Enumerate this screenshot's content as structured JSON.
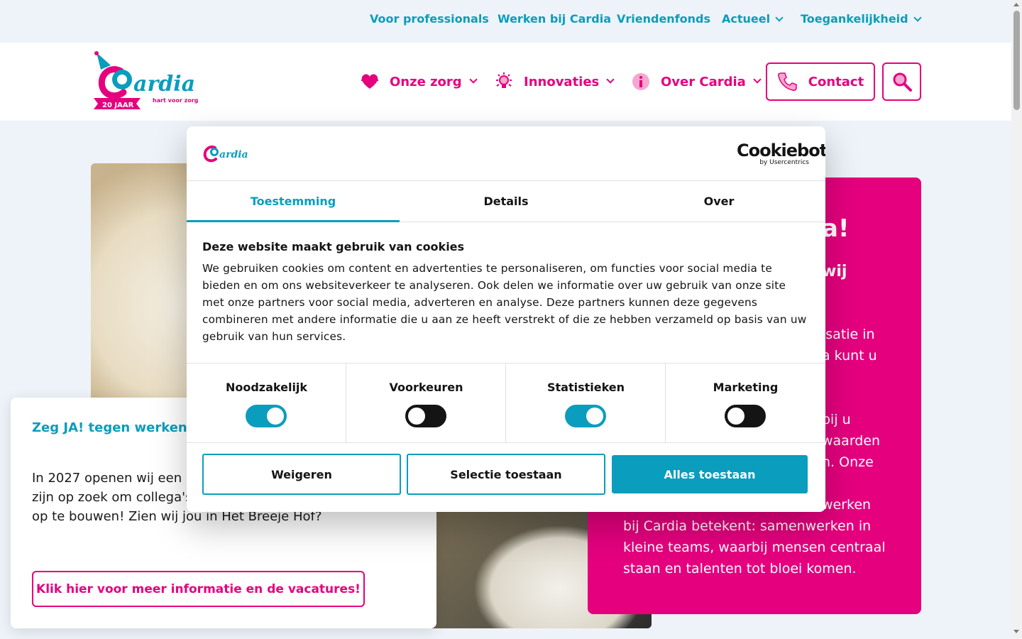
{
  "topbar": {
    "links": [
      "Voor professionals",
      "Werken bij Cardia",
      "Vriendenfonds",
      "Actueel",
      "Toegankelijkheid"
    ]
  },
  "brand": {
    "name": "Cardia",
    "tagline": "hart voor zorg",
    "badge": "20 JAAR",
    "pink": "#e5007e",
    "blue": "#0a9dbd"
  },
  "nav": {
    "items": [
      "Onze zorg",
      "Innovaties",
      "Over Cardia"
    ],
    "contact": "Contact"
  },
  "hero": {
    "heading_fragment": "a!",
    "subheading_fragment": "wij",
    "body_lines": [
      "isatie in",
      "a kunt u",
      "bij u",
      "waarden",
      "n. Onze",
      "werken",
      "bij Cardia betekent: samenwerken in",
      "kleine teams, waarbij mensen centraal",
      "staan en talenten tot bloei komen."
    ]
  },
  "card": {
    "title": "Zeg JA! tegen werken in locatie Het Breeje Hof in",
    "text": "In 2027 openen wij een nieuwe locatie Het Breeje Hof. We zijn op zoek om collega's te vinden om een nieuwe locatie op te bouwen! Zien wij jou in Het Breeje Hof?",
    "button": "Klik hier voor meer informatie en de vacatures!"
  },
  "cookie": {
    "provider": "Cookiebot",
    "provider_sub": "by Usercentrics",
    "tabs": [
      "Toestemming",
      "Details",
      "Over"
    ],
    "active_tab": "Toestemming",
    "title": "Deze website maakt gebruik van cookies",
    "text": "We gebruiken cookies om content en advertenties te personaliseren, om functies voor social media te bieden en om ons websiteverkeer te analyseren. Ook delen we informatie over uw gebruik van onze site met onze partners voor social media, adverteren en analyse. Deze partners kunnen deze gegevens combineren met andere informatie die u aan ze heeft verstrekt of die ze hebben verzameld op basis van uw gebruik van hun services.",
    "preferences": [
      {
        "label": "Noodzakelijk",
        "enabled": true
      },
      {
        "label": "Voorkeuren",
        "enabled": false
      },
      {
        "label": "Statistieken",
        "enabled": true
      },
      {
        "label": "Marketing",
        "enabled": false
      }
    ],
    "buttons": {
      "deny": "Weigeren",
      "selection": "Selectie toestaan",
      "allow_all": "Alles toestaan"
    }
  }
}
